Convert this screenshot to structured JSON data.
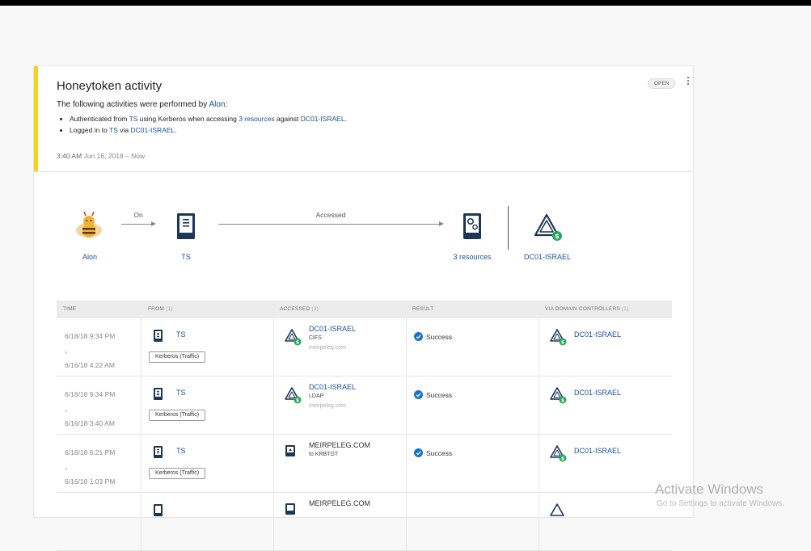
{
  "alert": {
    "title": "Honeytoken activity",
    "status": "OPEN",
    "intro_text": "The following activities were performed by",
    "intro_user": "Alon",
    "intro_colon": ":",
    "bullet1": {
      "p1": "Authenticated from ",
      "source": "TS",
      "p2": " using Kerberos when accessing ",
      "resources": "3 resources",
      "p3": " against ",
      "target": "DC01-ISRAEL",
      "p4": "."
    },
    "bullet2": {
      "p1": "Logged in to ",
      "source": "TS",
      "p2": " via ",
      "target": "DC01-ISRAEL",
      "p3": "."
    },
    "time_main": "3:40 AM",
    "time_rest": "Jun 16, 2018 – Now"
  },
  "flow": {
    "user": "Alon",
    "on_label": "On",
    "computer": "TS",
    "accessed_label": "Accessed",
    "resources": "3 resources",
    "dc": "DC01-ISRAEL"
  },
  "table": {
    "headers": {
      "time": "TIME",
      "from": "FROM",
      "from_count": "(1)",
      "accessed": "ACCESSED",
      "accessed_count": "(3)",
      "result": "RESULT",
      "via": "VIA DOMAIN CONTROLLERS",
      "via_count": "(1)"
    },
    "caret": "^",
    "rows": [
      {
        "t1": "6/18/18 9:34 PM",
        "t2": "6/16/18 4:22 AM",
        "from": "TS",
        "tag": "Kerberos (Traffic)",
        "acc_name": "DC01-ISRAEL",
        "acc_proto": "CIFS",
        "acc_domain": "meirpeleg.com",
        "result": "Success",
        "via": "DC01-ISRAEL"
      },
      {
        "t1": "6/18/18 9:34 PM",
        "t2": "6/16/18 3:40 AM",
        "from": "TS",
        "tag": "Kerberos (Traffic)",
        "acc_name": "DC01-ISRAEL",
        "acc_proto": "LDAP",
        "acc_domain": "meirpeleg.com",
        "result": "Success",
        "via": "DC01-ISRAEL"
      },
      {
        "t1": "6/18/18 6:21 PM",
        "t2": "6/16/18 1:03 PM",
        "from": "TS",
        "tag": "Kerberos (Traffic)",
        "acc_name": "MEIRPELEG.COM",
        "acc_proto": "to KRBTGT",
        "acc_domain": "",
        "result": "Success",
        "via": "DC01-ISRAEL"
      },
      {
        "t1": "",
        "t2": "",
        "from": "",
        "tag": "",
        "acc_name": "MEIRPELEG.COM",
        "acc_proto": "",
        "acc_domain": "",
        "result": "",
        "via": ""
      }
    ]
  },
  "watermark": {
    "line1": "Activate Windows",
    "line2": "Go to Settings to activate Windows."
  },
  "colors": {
    "accent_link": "#1a4f9c",
    "alert_bar": "#f7d117",
    "success": "#1a73c9",
    "dc_badge": "#27a85a"
  }
}
